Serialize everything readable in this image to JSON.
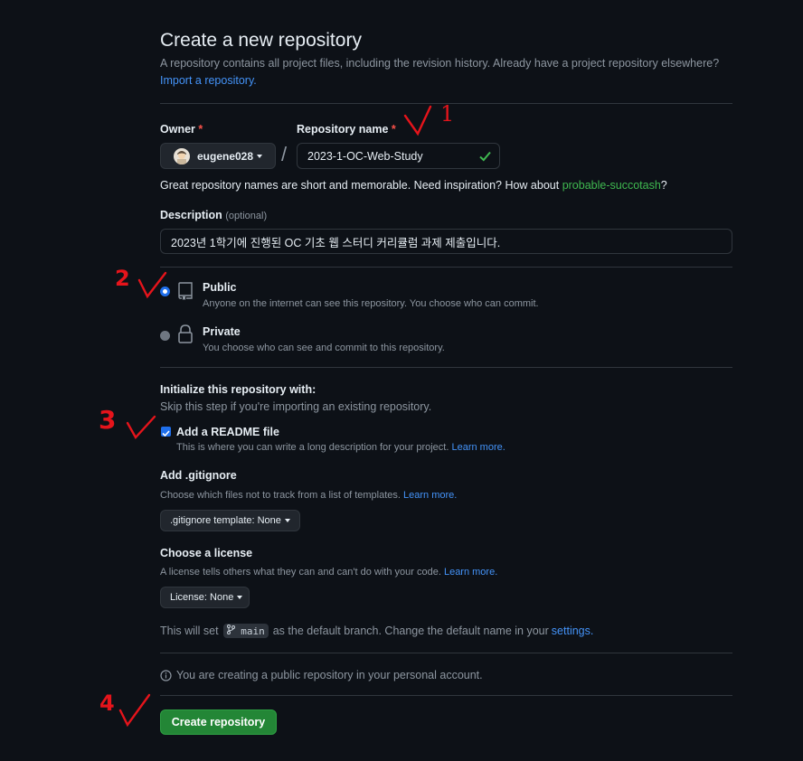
{
  "header": {
    "title": "Create a new repository",
    "description": "A repository contains all project files, including the revision history. Already have a project repository elsewhere?",
    "import_link": "Import a repository."
  },
  "owner": {
    "label": "Owner",
    "required": "*",
    "value": "eugene028"
  },
  "separator": "/",
  "repo_name": {
    "label": "Repository name",
    "required": "*",
    "value": "2023-1-OC-Web-Study"
  },
  "name_hint": {
    "text": "Great repository names are short and memorable. Need inspiration? How about",
    "suggestion": "probable-succotash",
    "end": "?"
  },
  "description": {
    "label": "Description",
    "optional": "(optional)",
    "value": "2023년 1학기에 진행된 OC 기초 웹 스터디 커리큘럼 과제 제출입니다."
  },
  "visibility": {
    "public": {
      "label": "Public",
      "desc": "Anyone on the internet can see this repository. You choose who can commit.",
      "selected": true
    },
    "private": {
      "label": "Private",
      "desc": "You choose who can see and commit to this repository.",
      "selected": false
    }
  },
  "init": {
    "heading": "Initialize this repository with:",
    "subheading": "Skip this step if you're importing an existing repository.",
    "readme": {
      "label": "Add a README file",
      "desc": "This is where you can write a long description for your project.",
      "link": "Learn more.",
      "checked": true
    }
  },
  "gitignore": {
    "label": "Add .gitignore",
    "desc": "Choose which files not to track from a list of templates.",
    "link": "Learn more.",
    "button": ".gitignore template: None"
  },
  "license": {
    "label": "Choose a license",
    "desc": "A license tells others what they can and can't do with your code.",
    "link": "Learn more.",
    "button": "License: None"
  },
  "branch": {
    "pre": "This will set",
    "name": "main",
    "mid": "as the default branch. Change the default name in your",
    "link": "settings",
    "end": "."
  },
  "notice": "You are creating a public repository in your personal account.",
  "submit": "Create repository",
  "annotations": {
    "one": "1",
    "two": "2",
    "three": "3",
    "four": "4"
  },
  "colors": {
    "accent": "#4493f8",
    "success": "#238636",
    "danger": "#f85149",
    "annotation": "#e5141b"
  }
}
